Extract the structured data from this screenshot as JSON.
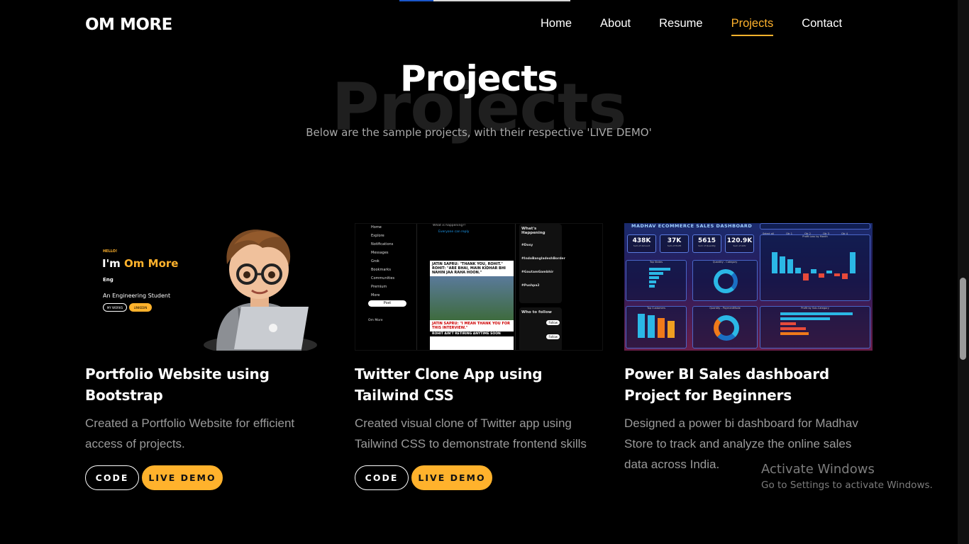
{
  "brand": "OM MORE",
  "nav": {
    "items": [
      {
        "label": "Home"
      },
      {
        "label": "About"
      },
      {
        "label": "Resume"
      },
      {
        "label": "Projects"
      },
      {
        "label": "Contact"
      }
    ],
    "active_index": 3
  },
  "page_progress_percent": 20,
  "section": {
    "background_word": "Projects",
    "title": "Projects",
    "subtitle": "Below are the sample projects, with their respective 'LIVE DEMO'"
  },
  "projects": [
    {
      "title": "Portfolio Website using Bootstrap",
      "description": "Created a Portfolio Website for efficient access of projects.",
      "code_label": "CODE",
      "demo_label": "LIVE DEMO",
      "preview": {
        "hello": "HELLO!",
        "im": "I'm",
        "name": "Om More",
        "eng": "Eng",
        "role": "An Engineering Student",
        "btn1": "MY WORKS",
        "btn2": "LINKEDIN"
      }
    },
    {
      "title": "Twitter Clone App using Tailwind CSS",
      "description": "Created visual clone of Twitter app using Tailwind CSS to demonstrate frontend skills",
      "code_label": "CODE",
      "demo_label": "LIVE DEMO",
      "preview": {
        "sidebar": [
          "Home",
          "Explore",
          "Notifications",
          "Messages",
          "Grok",
          "Bookmarks",
          "Communities",
          "Premium",
          "More"
        ],
        "post_button": "Post",
        "compose_placeholder": "What is happening?!",
        "reply_setting": "Everyone can reply",
        "trending_title": "What's Happening",
        "trends": [
          "#Dosy",
          "#IndoBangladeshBorder",
          "#GautamGambhir",
          "#Pushpa2"
        ],
        "follow_title": "Who to follow",
        "follow_button": "Follow",
        "headline1": "JATIN SAPRU: \"THANK YOU, ROHIT.\" ROHIT: \"ARE BHAI, MAIN KIDHAR BHI NAHIN JAA RAHA HOON.\"",
        "headline2": "JATIN SAPRU: \"I MEAN THANK YOU FOR THIS INTERVIEW.\"",
        "headline3": "ROHIT AIN'T RETIRING ANYTIME SOON",
        "user": "Om More"
      }
    },
    {
      "title": "Power BI Sales dashboard Project for Beginners",
      "description": "Designed a power bi dashboard for Madhav Store to track and analyze the online sales data across India.",
      "code_label": "CODE",
      "demo_label": "LIVE DEMO",
      "preview": {
        "dashboard_title": "MADHAV ECOMMERCE SALES DASHBOARD",
        "kpis": [
          {
            "value": "438K",
            "label": "Sum of Amount"
          },
          {
            "value": "37K",
            "label": "Sum of Profit"
          },
          {
            "value": "5615",
            "label": "Sum of Quantity"
          },
          {
            "value": "120.9K",
            "label": "Sum of AOV"
          }
        ],
        "filters": [
          "Select all",
          "Qtr 1",
          "Qtr 2",
          "Qtr 3",
          "Qtr 4"
        ],
        "panels": [
          "Top States",
          "Quantity - Category",
          "Profit Loss by Month",
          "Top Customers",
          "Quantity - PaymentMode",
          "Profit by Sub-Category"
        ]
      }
    }
  ],
  "watermark": {
    "line1": "Activate Windows",
    "line2": "Go to Settings to activate Windows."
  },
  "colors": {
    "accent": "#ffb22c",
    "background": "#000000",
    "muted_text": "#9a9a9a"
  }
}
